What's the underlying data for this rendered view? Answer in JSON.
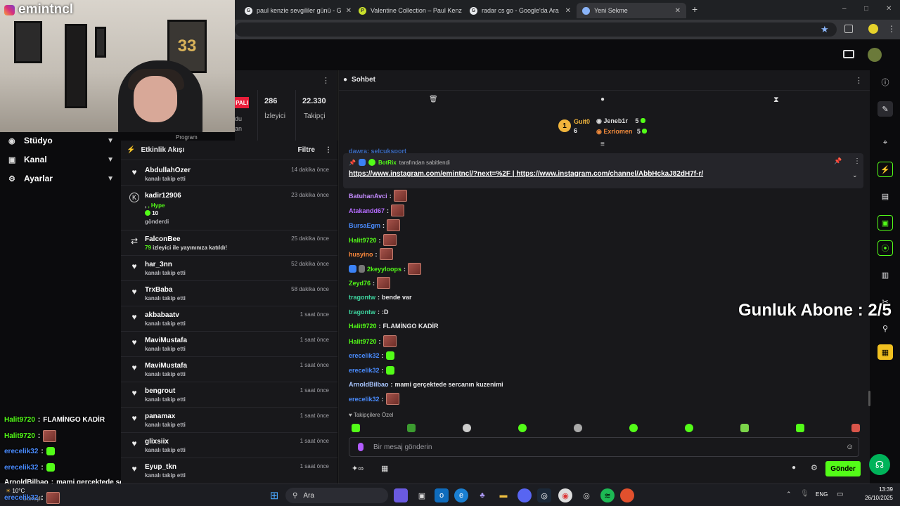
{
  "browser": {
    "tabs": [
      {
        "title": "paul kenzie sevgililer günü - G",
        "icon": "google-icon"
      },
      {
        "title": "Valentine Collection – Paul Kenz",
        "icon": "pk-icon"
      },
      {
        "title": "radar cs go - Google'da Ara",
        "icon": "google-icon"
      },
      {
        "title": "Yeni Sekme",
        "icon": "chrome-icon"
      }
    ],
    "new_tab": "+",
    "window_controls": [
      "–",
      "□",
      "✕"
    ]
  },
  "webcam": {
    "name": "emintncl",
    "poster_text": "33"
  },
  "leftnav": {
    "items": [
      {
        "label": "Stüdyo",
        "icon": "studio-icon"
      },
      {
        "label": "Kanal",
        "icon": "channel-icon"
      },
      {
        "label": "Ayarlar",
        "icon": "settings-icon"
      }
    ]
  },
  "stats": {
    "live_badge": "PALI",
    "viewers_value": "286",
    "viewers_label": "İzleyici",
    "followers_value": "22.330",
    "followers_label": "Takipçi",
    "partial_1": "du",
    "partial_2": "an",
    "partial_3": "Program"
  },
  "activity": {
    "title": "Etkinlik Akışı",
    "filter_label": "Filtre",
    "items": [
      {
        "name": "AbdullahOzer",
        "sub": "kanalı takip etti",
        "time": "14 dakika önce",
        "icon": "heart-icon"
      },
      {
        "name": "kadir12906",
        "sub": ", Hype",
        "sub2": "10",
        "sub3": "gönderdi",
        "time": "23 dakika önce",
        "icon": "kick-icon"
      },
      {
        "name": "FalconBee",
        "sub_count": "79",
        "sub": "izleyici ile yayınınıza katıldı!",
        "time": "25 dakika önce",
        "icon": "raid-icon"
      },
      {
        "name": "har_3nn",
        "sub": "kanalı takip etti",
        "time": "52 dakika önce",
        "icon": "heart-icon"
      },
      {
        "name": "TrxBaba",
        "sub": "kanalı takip etti",
        "time": "58 dakika önce",
        "icon": "heart-icon"
      },
      {
        "name": "akbabaatv",
        "sub": "kanalı takip etti",
        "time": "1 saat önce",
        "icon": "heart-icon"
      },
      {
        "name": "MaviMustafa",
        "sub": "kanalı takip etti",
        "time": "1 saat önce",
        "icon": "heart-icon"
      },
      {
        "name": "MaviMustafa",
        "sub": "kanalı takip etti",
        "time": "1 saat önce",
        "icon": "heart-icon"
      },
      {
        "name": "bengrout",
        "sub": "kanalı takip etti",
        "time": "1 saat önce",
        "icon": "heart-icon"
      },
      {
        "name": "panamax",
        "sub": "kanalı takip etti",
        "time": "1 saat önce",
        "icon": "heart-icon"
      },
      {
        "name": "glixsiix",
        "sub": "kanalı takip etti",
        "time": "1 saat önce",
        "icon": "heart-icon"
      },
      {
        "name": "Eyup_tkn",
        "sub": "kanalı takip etti",
        "time": "1 saat önce",
        "icon": "heart-icon"
      }
    ]
  },
  "chat": {
    "title": "Sohbet",
    "leaderboard": {
      "first": "Guit0",
      "first_score": "6",
      "second": "Jeneb1r",
      "second_score": "5",
      "third": "Exriomen",
      "third_score": "5",
      "rank_badge": "1"
    },
    "partial_top": "dawra: selcuksport",
    "pinned": {
      "by": "BotRix",
      "by_suffix": "tarafından sabitlendi",
      "link1": "https://www.instagram.com/emintncl/?next=%2F",
      "sep": "|",
      "link2": "https://www.instagram.com/channel/AbbHckaJ82dH7f-r/"
    },
    "messages": [
      {
        "user": "BatuhanAvci",
        "color": "#c58cff",
        "text": "",
        "emote": true
      },
      {
        "user": "Atakandd67",
        "color": "#b56cff",
        "text": "",
        "emote": true
      },
      {
        "user": "BursaEgm",
        "color": "#4a8cff",
        "text": "",
        "emote": true
      },
      {
        "user": "Halit9720",
        "color": "#53fc18",
        "text": "",
        "emote": true
      },
      {
        "user": "husyino",
        "color": "#ff8a3c",
        "text": "",
        "emote": true
      },
      {
        "user": "2keyyloops",
        "color": "#53fc18",
        "text": "",
        "emote": true,
        "badges": true
      },
      {
        "user": "Zeyd76",
        "color": "#53fc18",
        "text": "",
        "emote": true
      },
      {
        "user": "tragontw",
        "color": "#3ed6a0",
        "text": "bende var"
      },
      {
        "user": "tragontw",
        "color": "#3ed6a0",
        "text": ":D"
      },
      {
        "user": "Halit9720",
        "color": "#53fc18",
        "text": "FLAMİNGO KADİR"
      },
      {
        "user": "Halit9720",
        "color": "#53fc18",
        "text": "",
        "emote": true
      },
      {
        "user": "erecelik32",
        "color": "#4a8cff",
        "text": "",
        "gemo": true
      },
      {
        "user": "erecelik32",
        "color": "#4a8cff",
        "text": "",
        "gemo": true
      },
      {
        "user": "ArnoldBilbao",
        "color": "#a9c6ff",
        "text": "mami gerçektede sercanın kuzenimi"
      },
      {
        "user": "erecelik32",
        "color": "#4a8cff",
        "text": "",
        "emote": true
      }
    ],
    "follower_label": "Takipçilere Özel",
    "input_placeholder": "Bir mesaj gönderin",
    "send_label": "Gönder",
    "overlay_counter": "Gunluk Abone : 2/5"
  },
  "overlay_chat": [
    {
      "user": "Halit9720",
      "text": "FLAMİNGO KADİR",
      "color": "#53fc18"
    },
    {
      "user": "Halit9720",
      "text": "",
      "emote": true,
      "color": "#53fc18"
    },
    {
      "user": "erecelik32",
      "text": "",
      "gemo": true,
      "color": "#4a8cff"
    },
    {
      "user": "erecelik32",
      "text": "",
      "gemo": true,
      "color": "#4a8cff"
    },
    {
      "user": "ArnoldBilbao",
      "text": "mami gerçektede sercanın kuzenimi",
      "color": "#ffffff"
    },
    {
      "user": "erecelik32",
      "text": "",
      "emote": true,
      "color": "#4a8cff"
    }
  ],
  "taskbar": {
    "search_label": "Ara",
    "weather": "10°C",
    "weather_sub": "Güneşli",
    "lang": "ENG",
    "time": "13:39",
    "date": "26/10/2025"
  },
  "colors": {
    "accent": "#53fc18",
    "panel": "#18181b",
    "bg": "#0b0b0d"
  }
}
